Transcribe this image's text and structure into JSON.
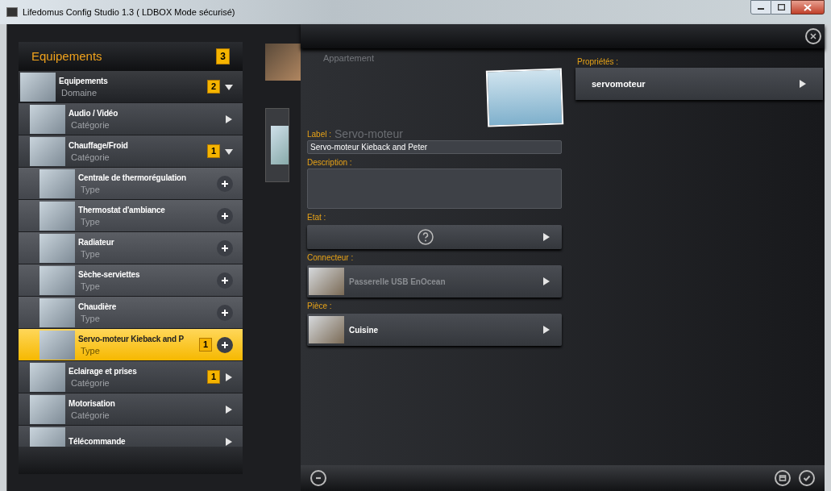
{
  "window": {
    "title": "Lifedomus Config Studio 1.3 ( LDBOX Mode sécurisé)"
  },
  "sidebar": {
    "title": "Equipements",
    "count": "3",
    "tree": [
      {
        "kind": "domain",
        "title": "Equipements",
        "subtitle": "Domaine",
        "badge": "2",
        "expanded": true,
        "selected": false,
        "children": [
          {
            "kind": "category",
            "title": "Audio / Vidéo",
            "subtitle": "Catégorie",
            "expanded": false,
            "selected": false
          },
          {
            "kind": "category",
            "title": "Chauffage/Froid",
            "subtitle": "Catégorie",
            "badge": "1",
            "expanded": true,
            "selected": false,
            "children": [
              {
                "kind": "type",
                "title": "Centrale de thermorégulation",
                "subtitle": "Type",
                "selected": false
              },
              {
                "kind": "type",
                "title": "Thermostat d'ambiance",
                "subtitle": "Type",
                "selected": false
              },
              {
                "kind": "type",
                "title": "Radiateur",
                "subtitle": "Type",
                "selected": false
              },
              {
                "kind": "type",
                "title": "Sèche-serviettes",
                "subtitle": "Type",
                "selected": false
              },
              {
                "kind": "type",
                "title": "Chaudière",
                "subtitle": "Type",
                "selected": false
              },
              {
                "kind": "type",
                "title": "Servo-moteur Kieback and P",
                "subtitle": "Type",
                "badge": "1",
                "selected": true
              }
            ]
          },
          {
            "kind": "category",
            "title": "Eclairage et prises",
            "subtitle": "Catégorie",
            "badge": "1",
            "expanded": false,
            "selected": false
          },
          {
            "kind": "category",
            "title": "Motorisation",
            "subtitle": "Catégorie",
            "expanded": false,
            "selected": false
          },
          {
            "kind": "category",
            "title": "Télécommande",
            "expanded": false,
            "selected": false
          }
        ]
      }
    ]
  },
  "background": {
    "location": "Appartement",
    "item": "Servo-moteur"
  },
  "form": {
    "fields": [
      {
        "kind": "text",
        "label": "Label :",
        "value": "Servo-moteur Kieback and Peter"
      },
      {
        "kind": "textarea",
        "label": "Description :"
      },
      {
        "kind": "picker",
        "label": "Etat :"
      },
      {
        "kind": "picker",
        "label": "Connecteur :",
        "value": "Passerelle USB EnOcean",
        "muted": true
      },
      {
        "kind": "picker",
        "label": "Pièce :",
        "value": "Cuisine",
        "muted": false
      }
    ]
  },
  "properties": {
    "label": "Propriétés :",
    "items": [
      {
        "title": "servomoteur"
      }
    ]
  }
}
